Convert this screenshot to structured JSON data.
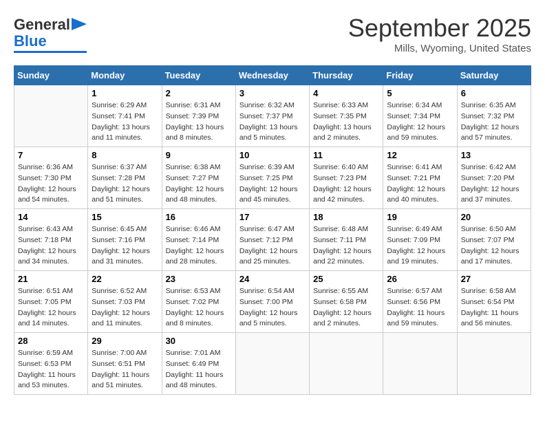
{
  "logo": {
    "line1": "General",
    "line2": "Blue"
  },
  "title": "September 2025",
  "location": "Mills, Wyoming, United States",
  "days_header": [
    "Sunday",
    "Monday",
    "Tuesday",
    "Wednesday",
    "Thursday",
    "Friday",
    "Saturday"
  ],
  "weeks": [
    [
      {
        "day": "",
        "sunrise": "",
        "sunset": "",
        "daylight": ""
      },
      {
        "day": "1",
        "sunrise": "Sunrise: 6:29 AM",
        "sunset": "Sunset: 7:41 PM",
        "daylight": "Daylight: 13 hours and 11 minutes."
      },
      {
        "day": "2",
        "sunrise": "Sunrise: 6:31 AM",
        "sunset": "Sunset: 7:39 PM",
        "daylight": "Daylight: 13 hours and 8 minutes."
      },
      {
        "day": "3",
        "sunrise": "Sunrise: 6:32 AM",
        "sunset": "Sunset: 7:37 PM",
        "daylight": "Daylight: 13 hours and 5 minutes."
      },
      {
        "day": "4",
        "sunrise": "Sunrise: 6:33 AM",
        "sunset": "Sunset: 7:35 PM",
        "daylight": "Daylight: 13 hours and 2 minutes."
      },
      {
        "day": "5",
        "sunrise": "Sunrise: 6:34 AM",
        "sunset": "Sunset: 7:34 PM",
        "daylight": "Daylight: 12 hours and 59 minutes."
      },
      {
        "day": "6",
        "sunrise": "Sunrise: 6:35 AM",
        "sunset": "Sunset: 7:32 PM",
        "daylight": "Daylight: 12 hours and 57 minutes."
      }
    ],
    [
      {
        "day": "7",
        "sunrise": "Sunrise: 6:36 AM",
        "sunset": "Sunset: 7:30 PM",
        "daylight": "Daylight: 12 hours and 54 minutes."
      },
      {
        "day": "8",
        "sunrise": "Sunrise: 6:37 AM",
        "sunset": "Sunset: 7:28 PM",
        "daylight": "Daylight: 12 hours and 51 minutes."
      },
      {
        "day": "9",
        "sunrise": "Sunrise: 6:38 AM",
        "sunset": "Sunset: 7:27 PM",
        "daylight": "Daylight: 12 hours and 48 minutes."
      },
      {
        "day": "10",
        "sunrise": "Sunrise: 6:39 AM",
        "sunset": "Sunset: 7:25 PM",
        "daylight": "Daylight: 12 hours and 45 minutes."
      },
      {
        "day": "11",
        "sunrise": "Sunrise: 6:40 AM",
        "sunset": "Sunset: 7:23 PM",
        "daylight": "Daylight: 12 hours and 42 minutes."
      },
      {
        "day": "12",
        "sunrise": "Sunrise: 6:41 AM",
        "sunset": "Sunset: 7:21 PM",
        "daylight": "Daylight: 12 hours and 40 minutes."
      },
      {
        "day": "13",
        "sunrise": "Sunrise: 6:42 AM",
        "sunset": "Sunset: 7:20 PM",
        "daylight": "Daylight: 12 hours and 37 minutes."
      }
    ],
    [
      {
        "day": "14",
        "sunrise": "Sunrise: 6:43 AM",
        "sunset": "Sunset: 7:18 PM",
        "daylight": "Daylight: 12 hours and 34 minutes."
      },
      {
        "day": "15",
        "sunrise": "Sunrise: 6:45 AM",
        "sunset": "Sunset: 7:16 PM",
        "daylight": "Daylight: 12 hours and 31 minutes."
      },
      {
        "day": "16",
        "sunrise": "Sunrise: 6:46 AM",
        "sunset": "Sunset: 7:14 PM",
        "daylight": "Daylight: 12 hours and 28 minutes."
      },
      {
        "day": "17",
        "sunrise": "Sunrise: 6:47 AM",
        "sunset": "Sunset: 7:12 PM",
        "daylight": "Daylight: 12 hours and 25 minutes."
      },
      {
        "day": "18",
        "sunrise": "Sunrise: 6:48 AM",
        "sunset": "Sunset: 7:11 PM",
        "daylight": "Daylight: 12 hours and 22 minutes."
      },
      {
        "day": "19",
        "sunrise": "Sunrise: 6:49 AM",
        "sunset": "Sunset: 7:09 PM",
        "daylight": "Daylight: 12 hours and 19 minutes."
      },
      {
        "day": "20",
        "sunrise": "Sunrise: 6:50 AM",
        "sunset": "Sunset: 7:07 PM",
        "daylight": "Daylight: 12 hours and 17 minutes."
      }
    ],
    [
      {
        "day": "21",
        "sunrise": "Sunrise: 6:51 AM",
        "sunset": "Sunset: 7:05 PM",
        "daylight": "Daylight: 12 hours and 14 minutes."
      },
      {
        "day": "22",
        "sunrise": "Sunrise: 6:52 AM",
        "sunset": "Sunset: 7:03 PM",
        "daylight": "Daylight: 12 hours and 11 minutes."
      },
      {
        "day": "23",
        "sunrise": "Sunrise: 6:53 AM",
        "sunset": "Sunset: 7:02 PM",
        "daylight": "Daylight: 12 hours and 8 minutes."
      },
      {
        "day": "24",
        "sunrise": "Sunrise: 6:54 AM",
        "sunset": "Sunset: 7:00 PM",
        "daylight": "Daylight: 12 hours and 5 minutes."
      },
      {
        "day": "25",
        "sunrise": "Sunrise: 6:55 AM",
        "sunset": "Sunset: 6:58 PM",
        "daylight": "Daylight: 12 hours and 2 minutes."
      },
      {
        "day": "26",
        "sunrise": "Sunrise: 6:57 AM",
        "sunset": "Sunset: 6:56 PM",
        "daylight": "Daylight: 11 hours and 59 minutes."
      },
      {
        "day": "27",
        "sunrise": "Sunrise: 6:58 AM",
        "sunset": "Sunset: 6:54 PM",
        "daylight": "Daylight: 11 hours and 56 minutes."
      }
    ],
    [
      {
        "day": "28",
        "sunrise": "Sunrise: 6:59 AM",
        "sunset": "Sunset: 6:53 PM",
        "daylight": "Daylight: 11 hours and 53 minutes."
      },
      {
        "day": "29",
        "sunrise": "Sunrise: 7:00 AM",
        "sunset": "Sunset: 6:51 PM",
        "daylight": "Daylight: 11 hours and 51 minutes."
      },
      {
        "day": "30",
        "sunrise": "Sunrise: 7:01 AM",
        "sunset": "Sunset: 6:49 PM",
        "daylight": "Daylight: 11 hours and 48 minutes."
      },
      {
        "day": "",
        "sunrise": "",
        "sunset": "",
        "daylight": ""
      },
      {
        "day": "",
        "sunrise": "",
        "sunset": "",
        "daylight": ""
      },
      {
        "day": "",
        "sunrise": "",
        "sunset": "",
        "daylight": ""
      },
      {
        "day": "",
        "sunrise": "",
        "sunset": "",
        "daylight": ""
      }
    ]
  ]
}
